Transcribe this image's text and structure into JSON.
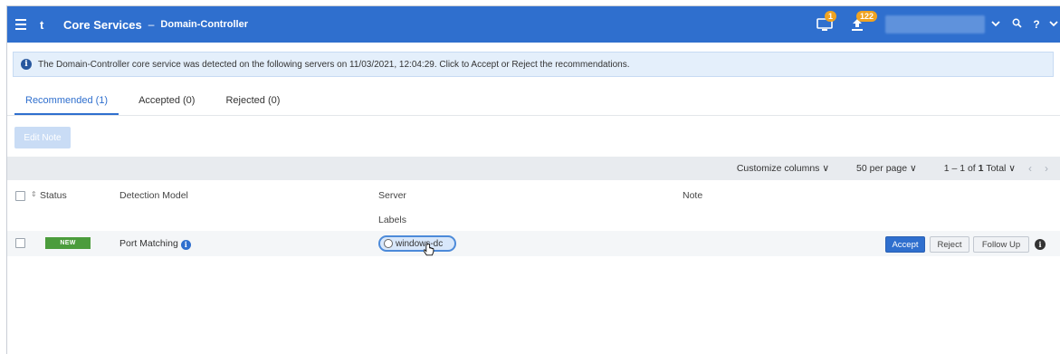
{
  "header": {
    "logo": "t",
    "app_title": "Core Services",
    "separator": "–",
    "sub_title": "Domain-Controller",
    "notif1_count": "1",
    "notif2_count": "122",
    "search_icon": "search-icon",
    "help": "?",
    "colors": {
      "bar": "#2f6fce",
      "badge": "#f0a321"
    }
  },
  "banner": {
    "icon": "i",
    "text": "The Domain-Controller core service was detected on the following servers on 11/03/2021, 12:04:29. Click to Accept or Reject the recommendations."
  },
  "tabs": [
    {
      "label": "Recommended (1)",
      "active": true
    },
    {
      "label": "Accepted (0)",
      "active": false
    },
    {
      "label": "Rejected (0)",
      "active": false
    }
  ],
  "toolbar": {
    "edit_note": "Edit Note",
    "customize_columns": "Customize columns ∨",
    "per_page": "50 per page ∨",
    "range_prefix": "1 – 1 of ",
    "range_total": "1",
    "range_suffix": " Total ∨",
    "prev": "‹",
    "next": "›"
  },
  "columns": {
    "status": "Status",
    "sort_marker": "⇕",
    "detection_model": "Detection Model",
    "server": "Server",
    "labels": "Labels",
    "note": "Note"
  },
  "rows": [
    {
      "status": "NEW",
      "detection_model": "Port Matching",
      "info": "i",
      "label": "windows-dc",
      "accept": "Accept",
      "reject": "Reject",
      "follow_up": "Follow Up"
    }
  ]
}
